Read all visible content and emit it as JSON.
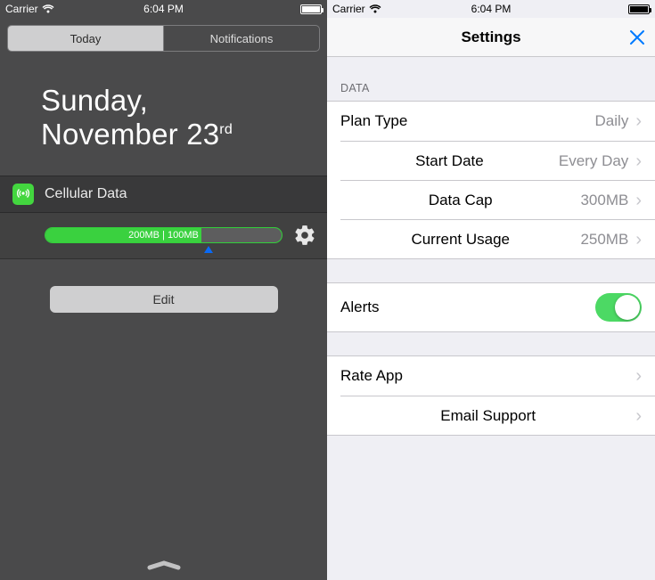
{
  "left": {
    "status": {
      "carrier": "Carrier",
      "time": "6:04 PM"
    },
    "tabs": {
      "today": "Today",
      "notifications": "Notifications"
    },
    "date": {
      "line1": "Sunday,",
      "line2a": "November 23",
      "line2b": "rd"
    },
    "widget": {
      "title": "Cellular Data",
      "bar_text": "200MB | 100MB"
    },
    "edit": "Edit"
  },
  "right": {
    "status": {
      "carrier": "Carrier",
      "time": "6:04 PM"
    },
    "title": "Settings",
    "section": "DATA",
    "rows": {
      "plan_type": {
        "label": "Plan Type",
        "value": "Daily"
      },
      "start_date": {
        "label": "Start Date",
        "value": "Every Day"
      },
      "data_cap": {
        "label": "Data Cap",
        "value": "300MB"
      },
      "current_usage": {
        "label": "Current Usage",
        "value": "250MB"
      }
    },
    "alerts": {
      "label": "Alerts",
      "on": true
    },
    "rate": "Rate App",
    "email": "Email Support"
  }
}
